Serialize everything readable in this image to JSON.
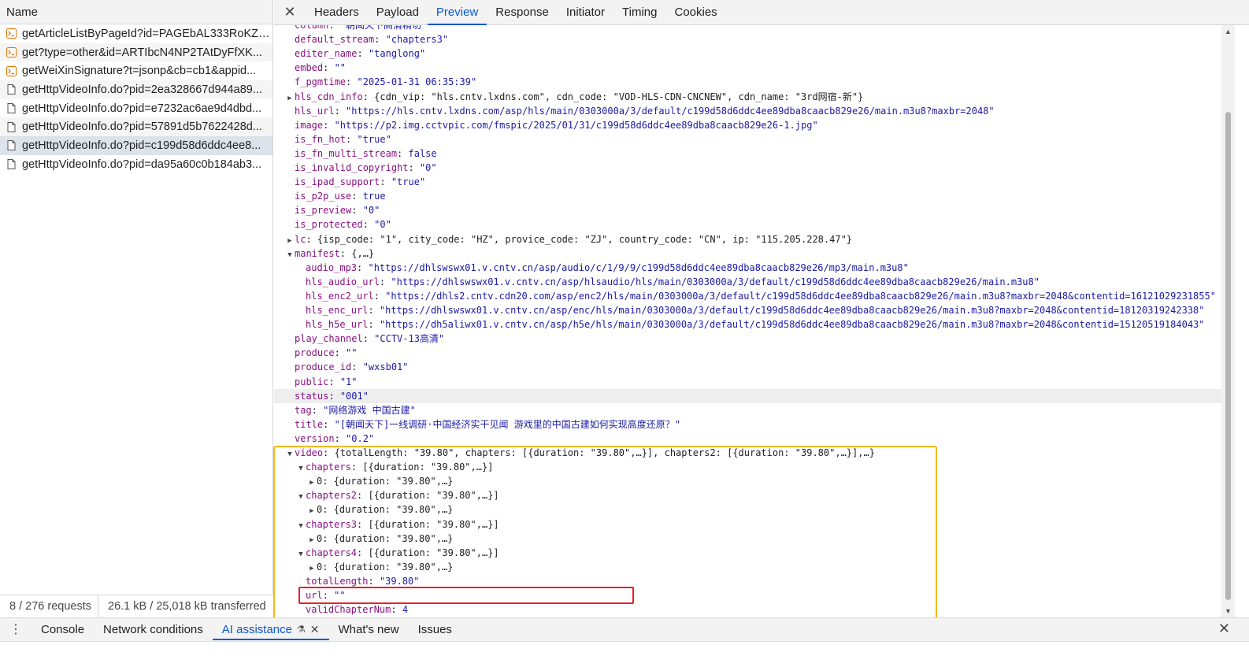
{
  "requests": {
    "header": "Name",
    "items": [
      {
        "name": "getArticleListByPageId?id=PAGEbAL333RoKZv...",
        "icon": "script-icon",
        "alt": false,
        "selected": false
      },
      {
        "name": "get?type=other&id=ARTIbcN4NP2TAtDyFfXK...",
        "icon": "script-icon",
        "alt": true,
        "selected": false
      },
      {
        "name": "getWeiXinSignature?t=jsonp&cb=cb1&appid...",
        "icon": "script-icon",
        "alt": false,
        "selected": false
      },
      {
        "name": "getHttpVideoInfo.do?pid=2ea328667d944a89...",
        "icon": "document-icon",
        "alt": true,
        "selected": false
      },
      {
        "name": "getHttpVideoInfo.do?pid=e7232ac6ae9d4dbd...",
        "icon": "document-icon",
        "alt": false,
        "selected": false
      },
      {
        "name": "getHttpVideoInfo.do?pid=57891d5b7622428d...",
        "icon": "document-icon",
        "alt": true,
        "selected": false
      },
      {
        "name": "getHttpVideoInfo.do?pid=c199d58d6ddc4ee8...",
        "icon": "document-icon",
        "alt": false,
        "selected": true
      },
      {
        "name": "getHttpVideoInfo.do?pid=da95a60c0b184ab3...",
        "icon": "document-icon",
        "alt": false,
        "selected": false
      }
    ]
  },
  "status": {
    "requests": "8 / 276 requests",
    "transferred": "26.1 kB / 25,018 kB transferred"
  },
  "tabs": {
    "close_icon": "close-icon",
    "items": [
      "Headers",
      "Payload",
      "Preview",
      "Response",
      "Initiator",
      "Timing",
      "Cookies"
    ],
    "active": "Preview"
  },
  "json_lines": [
    {
      "indent": 0,
      "tri": "",
      "key": "column",
      "value": "\"朝闻天下高清精切\"",
      "vtype": "s"
    },
    {
      "indent": 0,
      "tri": "",
      "key": "default_stream",
      "value": "\"chapters3\"",
      "vtype": "s"
    },
    {
      "indent": 0,
      "tri": "",
      "key": "editer_name",
      "value": "\"tanglong\"",
      "vtype": "s"
    },
    {
      "indent": 0,
      "tri": "",
      "key": "embed",
      "value": "\"\"",
      "vtype": "s"
    },
    {
      "indent": 0,
      "tri": "",
      "key": "f_pgmtime",
      "value": "\"2025-01-31 06:35:39\"",
      "vtype": "s"
    },
    {
      "indent": 0,
      "tri": "▶",
      "key": "hls_cdn_info",
      "value": "{cdn_vip: \"hls.cntv.lxdns.com\", cdn_code: \"VOD-HLS-CDN-CNCNEW\", cdn_name: \"3rd网宿-新\"}",
      "vtype": "p"
    },
    {
      "indent": 0,
      "tri": "",
      "key": "hls_url",
      "value": "\"https://hls.cntv.lxdns.com/asp/hls/main/0303000a/3/default/c199d58d6ddc4ee89dba8caacb829e26/main.m3u8?maxbr=2048\"",
      "vtype": "s"
    },
    {
      "indent": 0,
      "tri": "",
      "key": "image",
      "value": "\"https://p2.img.cctvpic.com/fmspic/2025/01/31/c199d58d6ddc4ee89dba8caacb829e26-1.jpg\"",
      "vtype": "s"
    },
    {
      "indent": 0,
      "tri": "",
      "key": "is_fn_hot",
      "value": "\"true\"",
      "vtype": "s"
    },
    {
      "indent": 0,
      "tri": "",
      "key": "is_fn_multi_stream",
      "value": "false",
      "vtype": "b"
    },
    {
      "indent": 0,
      "tri": "",
      "key": "is_invalid_copyright",
      "value": "\"0\"",
      "vtype": "s"
    },
    {
      "indent": 0,
      "tri": "",
      "key": "is_ipad_support",
      "value": "\"true\"",
      "vtype": "s"
    },
    {
      "indent": 0,
      "tri": "",
      "key": "is_p2p_use",
      "value": "true",
      "vtype": "b"
    },
    {
      "indent": 0,
      "tri": "",
      "key": "is_preview",
      "value": "\"0\"",
      "vtype": "s"
    },
    {
      "indent": 0,
      "tri": "",
      "key": "is_protected",
      "value": "\"0\"",
      "vtype": "s"
    },
    {
      "indent": 0,
      "tri": "▶",
      "key": "lc",
      "value": "{isp_code: \"1\", city_code: \"HZ\", provice_code: \"ZJ\", country_code: \"CN\", ip: \"115.205.228.47\"}",
      "vtype": "p"
    },
    {
      "indent": 0,
      "tri": "▼",
      "key": "manifest",
      "value": "{,…}",
      "vtype": "p"
    },
    {
      "indent": 1,
      "tri": "",
      "key": "audio_mp3",
      "value": "\"https://dhlswswx01.v.cntv.cn/asp/audio/c/1/9/9/c199d58d6ddc4ee89dba8caacb829e26/mp3/main.m3u8\"",
      "vtype": "s"
    },
    {
      "indent": 1,
      "tri": "",
      "key": "hls_audio_url",
      "value": "\"https://dhlswswx01.v.cntv.cn/asp/hlsaudio/hls/main/0303000a/3/default/c199d58d6ddc4ee89dba8caacb829e26/main.m3u8\"",
      "vtype": "s"
    },
    {
      "indent": 1,
      "tri": "",
      "key": "hls_enc2_url",
      "value": "\"https://dhls2.cntv.cdn20.com/asp/enc2/hls/main/0303000a/3/default/c199d58d6ddc4ee89dba8caacb829e26/main.m3u8?maxbr=2048&contentid=16121029231855\"",
      "vtype": "s"
    },
    {
      "indent": 1,
      "tri": "",
      "key": "hls_enc_url",
      "value": "\"https://dhlswswx01.v.cntv.cn/asp/enc/hls/main/0303000a/3/default/c199d58d6ddc4ee89dba8caacb829e26/main.m3u8?maxbr=2048&contentid=18120319242338\"",
      "vtype": "s"
    },
    {
      "indent": 1,
      "tri": "",
      "key": "hls_h5e_url",
      "value": "\"https://dh5aliwx01.v.cntv.cn/asp/h5e/hls/main/0303000a/3/default/c199d58d6ddc4ee89dba8caacb829e26/main.m3u8?maxbr=2048&contentid=15120519184043\"",
      "vtype": "s"
    },
    {
      "indent": 0,
      "tri": "",
      "key": "play_channel",
      "value": "\"CCTV-13高清\"",
      "vtype": "s"
    },
    {
      "indent": 0,
      "tri": "",
      "key": "produce",
      "value": "\"\"",
      "vtype": "s"
    },
    {
      "indent": 0,
      "tri": "",
      "key": "produce_id",
      "value": "\"wxsb01\"",
      "vtype": "s"
    },
    {
      "indent": 0,
      "tri": "",
      "key": "public",
      "value": "\"1\"",
      "vtype": "s"
    },
    {
      "indent": 0,
      "tri": "",
      "key": "status",
      "value": "\"001\"",
      "vtype": "s",
      "hl": true
    },
    {
      "indent": 0,
      "tri": "",
      "key": "tag",
      "value": "\"网络游戏 中国古建\"",
      "vtype": "s"
    },
    {
      "indent": 0,
      "tri": "",
      "key": "title",
      "value": "\"[朝闻天下]一线调研·中国经济实干见闻 游戏里的中国古建如何实现高度还原？\"",
      "vtype": "s"
    },
    {
      "indent": 0,
      "tri": "",
      "key": "version",
      "value": "\"0.2\"",
      "vtype": "s"
    },
    {
      "indent": 0,
      "tri": "▼",
      "key": "video",
      "value": "{totalLength: \"39.80\", chapters: [{duration: \"39.80\",…}], chapters2: [{duration: \"39.80\",…}],…}",
      "vtype": "p"
    },
    {
      "indent": 1,
      "tri": "▼",
      "key": "chapters",
      "value": "[{duration: \"39.80\",…}]",
      "vtype": "p"
    },
    {
      "indent": 2,
      "tri": "▶",
      "key": "0",
      "value": "{duration: \"39.80\",…}",
      "vtype": "p",
      "plainkey": true
    },
    {
      "indent": 1,
      "tri": "▼",
      "key": "chapters2",
      "value": "[{duration: \"39.80\",…}]",
      "vtype": "p"
    },
    {
      "indent": 2,
      "tri": "▶",
      "key": "0",
      "value": "{duration: \"39.80\",…}",
      "vtype": "p",
      "plainkey": true
    },
    {
      "indent": 1,
      "tri": "▼",
      "key": "chapters3",
      "value": "[{duration: \"39.80\",…}]",
      "vtype": "p"
    },
    {
      "indent": 2,
      "tri": "▶",
      "key": "0",
      "value": "{duration: \"39.80\",…}",
      "vtype": "p",
      "plainkey": true
    },
    {
      "indent": 1,
      "tri": "▼",
      "key": "chapters4",
      "value": "[{duration: \"39.80\",…}]",
      "vtype": "p"
    },
    {
      "indent": 2,
      "tri": "▶",
      "key": "0",
      "value": "{duration: \"39.80\",…}",
      "vtype": "p",
      "plainkey": true
    },
    {
      "indent": 1,
      "tri": "",
      "key": "totalLength",
      "value": "\"39.80\"",
      "vtype": "s"
    },
    {
      "indent": 1,
      "tri": "",
      "key": "url",
      "value": "\"\"",
      "vtype": "s"
    },
    {
      "indent": 1,
      "tri": "",
      "key": "validChapterNum",
      "value": "4",
      "vtype": "n"
    }
  ],
  "drawer": {
    "menu_icon": "more-vertical-icon",
    "tabs": [
      {
        "label": "Console",
        "active": false
      },
      {
        "label": "Network conditions",
        "active": false
      },
      {
        "label": "AI assistance",
        "active": true
      },
      {
        "label": "What's new",
        "active": false
      },
      {
        "label": "Issues",
        "active": false
      }
    ],
    "close_icon": "close-icon"
  },
  "colors": {
    "highlight_orange": "#f5b715",
    "highlight_red": "#e8202a",
    "accent": "#0b57d0"
  }
}
